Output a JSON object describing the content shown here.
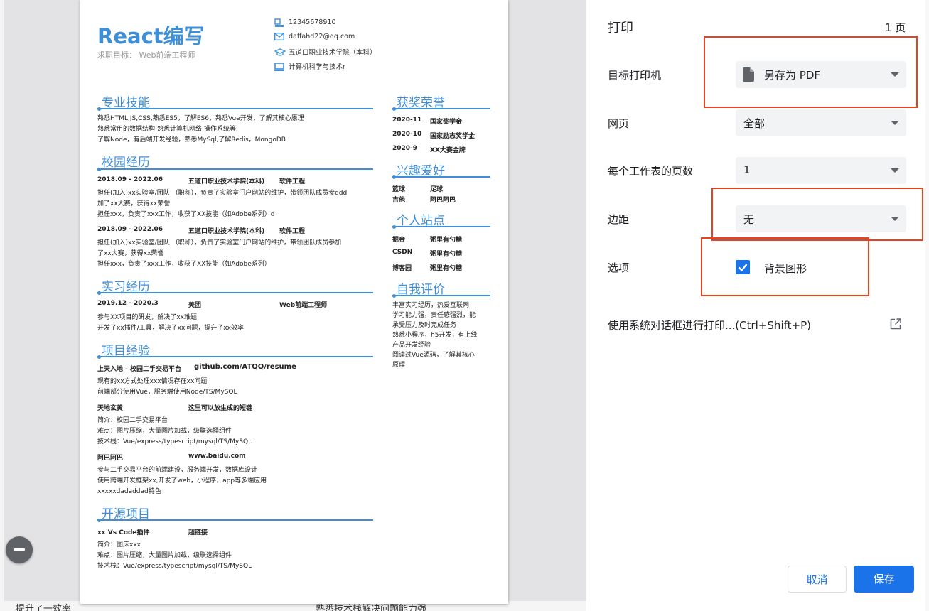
{
  "background": {
    "bottom_left_text": "提升了一效率",
    "bottom_mid_text": "熟悉技术栈解决问题能力强"
  },
  "resume": {
    "name": "React编写",
    "target": "求职目标：  Web前端工程师",
    "contacts": [
      {
        "icon": "phone-icon",
        "text": "12345678910"
      },
      {
        "icon": "email-icon",
        "text": "daffahd22@qq.com"
      },
      {
        "icon": "graduation-cap-icon",
        "text": "五道口职业技术学院（本科）"
      },
      {
        "icon": "laptop-icon",
        "text": "计算机科学与技术r"
      }
    ],
    "skills": {
      "title": "专业技能",
      "lines": [
        "熟悉HTML,JS,CSS,熟悉ES5，了解ES6，熟悉Vue开发，了解其核心原理",
        "熟悉常用的数据结构;熟悉计算机网络,操作系统等;",
        "了解Node，有后端开发经验，熟悉MySql,了解Redis，MongoDB"
      ]
    },
    "campus": {
      "title": "校园经历",
      "entries": [
        {
          "date": "2018.09 - 2022.06",
          "school": "五道口职业技术学院(本科)",
          "major": "软件工程",
          "lines": [
            "担任(加入)xx实验室/团队 （职称），负责了实验室门户网站的维护，带领团队成员参ddd",
            "加了xx大赛，获得xx荣誉",
            "担任xxx，负责了xxx工作，收获了XX技能（如Adobe系列）d"
          ]
        },
        {
          "date": "2018.09 - 2022.06",
          "school": "五道口职业技术学院(本科)",
          "major": "软件工程",
          "lines": [
            "担任(加入)xx实验室/团队 （职称），负责了实验室门户网站的维护，带领团队成员参加",
            "了xx大赛，获得xx荣誉",
            "担任xxx，负责了xxx工作，收获了XX技能（如Adobe系列）"
          ]
        }
      ]
    },
    "intern": {
      "title": "实习经历",
      "date": "2019.12 - 2020.3",
      "company": "美团",
      "role": "Web前端工程师",
      "lines": [
        "参与XX项目的研发，解决了xx难题",
        "开发了xx插件/工具，解决了xx问题，提升了xx效率"
      ]
    },
    "projects": {
      "title": "项目经验",
      "entries": [
        {
          "name": "上天入地 - 校园二手交易平台",
          "link": "github.com/ATQQ/resume",
          "lines": [
            "现有的xx方式处理xxx情况存在xx问题",
            "前端部分使用Vue，服务端使用Node/TS/MySQL"
          ]
        },
        {
          "name": "天地玄黄",
          "link": "这里可以放生成的短链",
          "lines": [
            "简介：校园二手交易平台",
            "难点：图片压缩，大量图片加载，级联选择组件",
            "技术栈：Vue/express/typescript/mysql/TS/MySQL"
          ]
        },
        {
          "name": "阿巴阿巴",
          "link": "www.baidu.com",
          "lines": [
            "参与二手交易平台的前端建设，服务端开发，数据库设计",
            "使用跨端开发框架xx,开发了web，小程序，app等多端应用",
            "xxxxxdadaddad特色"
          ]
        }
      ]
    },
    "opensource": {
      "title": "开源项目",
      "name": "xx Vs Code插件",
      "link": "超链接",
      "lines": [
        "简介：图床xxx",
        "难点：图片压缩，大量图片加载，级联选择组件",
        "技术栈：Vue/express/typescript/mysql/TS/MySQL"
      ]
    },
    "awards": {
      "title": "获奖荣誉",
      "items": [
        {
          "year": "2020-11",
          "name": "国家奖学金"
        },
        {
          "year": "2020-10",
          "name": "国家励志奖学金"
        },
        {
          "year": "2020-9",
          "name": "XX大赛金牌"
        }
      ]
    },
    "hobbies": {
      "title": "兴趣爱好",
      "items": [
        {
          "a": "篮球",
          "b": "足球"
        },
        {
          "a": "吉他",
          "b": "阿巴阿巴"
        }
      ]
    },
    "sites": {
      "title": "个人站点",
      "items": [
        {
          "a": "掘金",
          "b": "粥里有勺糖"
        },
        {
          "a": "CSDN",
          "b": "粥里有勺糖"
        },
        {
          "a": "博客园",
          "b": "粥里有勺糖"
        }
      ]
    },
    "self": {
      "title": "自我评价",
      "lines": [
        "丰富实习经历，热爱互联网",
        "学习能力强，责任感强烈，能",
        "承受压力及时完成任务",
        "熟悉小程序，h5开发，有上线",
        "产品开发经验",
        "阅读过Vue源码，了解其核心",
        "原理"
      ]
    }
  },
  "print_dialog": {
    "title": "打印",
    "page_count": "1 页",
    "destination_label": "目标打印机",
    "destination_value": "另存为 PDF",
    "pages_label": "网页",
    "pages_value": "全部",
    "pages_per_sheet_label": "每个工作表的页数",
    "pages_per_sheet_value": "1",
    "margins_label": "边距",
    "margins_value": "无",
    "options_label": "选项",
    "background_graphics_label": "背景图形",
    "background_graphics_checked": true,
    "system_dialog_label": "使用系统对话框进行打印...(Ctrl+Shift+P)",
    "cancel_label": "取消",
    "save_label": "保存"
  },
  "colors": {
    "accent": "#1a73e8",
    "resume_blue": "#3f8fd8",
    "highlight_red": "#e8431f"
  }
}
